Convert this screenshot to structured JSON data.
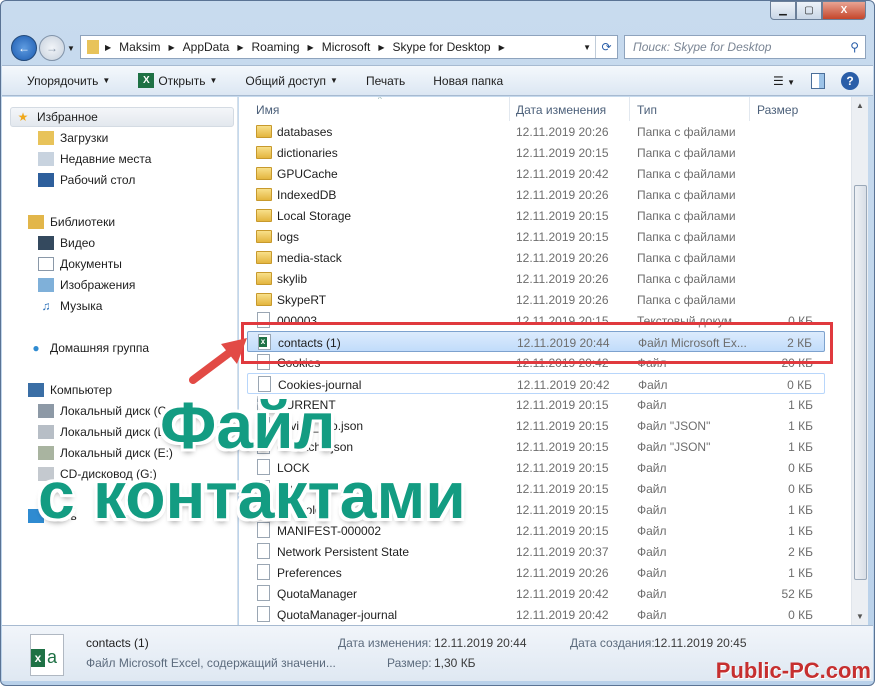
{
  "address": {
    "crumbs": [
      "Maksim",
      "AppData",
      "Roaming",
      "Microsoft",
      "Skype for Desktop"
    ]
  },
  "search": {
    "placeholder": "Поиск: Skype for Desktop"
  },
  "toolbar": {
    "organize": "Упорядочить",
    "open": "Открыть",
    "share": "Общий доступ",
    "print": "Печать",
    "new_folder": "Новая папка"
  },
  "sidebar": {
    "favorites": "Избранное",
    "downloads": "Загрузки",
    "recent": "Недавние места",
    "desktop": "Рабочий стол",
    "libraries": "Библиотеки",
    "video": "Видео",
    "documents": "Документы",
    "images": "Изображения",
    "music": "Музыка",
    "homegroup": "Домашняя группа",
    "computer": "Компьютер",
    "disk_c": "Локальный диск (C:)",
    "disk_d": "Локальный диск (D:)",
    "disk_e": "Локальный диск (E:)",
    "cd": "CD-дисковод (G:)",
    "network": "Сеть"
  },
  "columns": {
    "name": "Имя",
    "date": "Дата изменения",
    "type": "Тип",
    "size": "Размер"
  },
  "files": [
    {
      "name": "databases",
      "date": "12.11.2019 20:26",
      "type": "Папка с файлами",
      "size": "",
      "kind": "folder"
    },
    {
      "name": "dictionaries",
      "date": "12.11.2019 20:15",
      "type": "Папка с файлами",
      "size": "",
      "kind": "folder"
    },
    {
      "name": "GPUCache",
      "date": "12.11.2019 20:42",
      "type": "Папка с файлами",
      "size": "",
      "kind": "folder"
    },
    {
      "name": "IndexedDB",
      "date": "12.11.2019 20:26",
      "type": "Папка с файлами",
      "size": "",
      "kind": "folder"
    },
    {
      "name": "Local Storage",
      "date": "12.11.2019 20:15",
      "type": "Папка с файлами",
      "size": "",
      "kind": "folder"
    },
    {
      "name": "logs",
      "date": "12.11.2019 20:15",
      "type": "Папка с файлами",
      "size": "",
      "kind": "folder"
    },
    {
      "name": "media-stack",
      "date": "12.11.2019 20:26",
      "type": "Папка с файлами",
      "size": "",
      "kind": "folder"
    },
    {
      "name": "skylib",
      "date": "12.11.2019 20:26",
      "type": "Папка с файлами",
      "size": "",
      "kind": "folder"
    },
    {
      "name": "SkypeRT",
      "date": "12.11.2019 20:26",
      "type": "Папка с файлами",
      "size": "",
      "kind": "folder"
    },
    {
      "name": "000003",
      "date": "12.11.2019 20:15",
      "type": "Текстовый докум...",
      "size": "0 КБ",
      "kind": "file"
    },
    {
      "name": "contacts (1)",
      "date": "12.11.2019 20:44",
      "type": "Файл Microsoft Ex...",
      "size": "2 КБ",
      "kind": "xls",
      "state": "sel"
    },
    {
      "name": "Cookies",
      "date": "12.11.2019 20:42",
      "type": "Файл",
      "size": "20 КБ",
      "kind": "file"
    },
    {
      "name": "Cookies-journal",
      "date": "12.11.2019 20:42",
      "type": "Файл",
      "size": "0 КБ",
      "kind": "file",
      "state": "hov"
    },
    {
      "name": "CURRENT",
      "date": "12.11.2019 20:15",
      "type": "Файл",
      "size": "1 КБ",
      "kind": "file"
    },
    {
      "name": "device_info.json",
      "date": "12.11.2019 20:15",
      "type": "Файл \"JSON\"",
      "size": "1 КБ",
      "kind": "file"
    },
    {
      "name": "ecscache.json",
      "date": "12.11.2019 20:15",
      "type": "Файл \"JSON\"",
      "size": "1 КБ",
      "kind": "file"
    },
    {
      "name": "LOCK",
      "date": "12.11.2019 20:15",
      "type": "Файл",
      "size": "0 КБ",
      "kind": "file"
    },
    {
      "name": "LOG",
      "date": "12.11.2019 20:15",
      "type": "Файл",
      "size": "0 КБ",
      "kind": "file"
    },
    {
      "name": "LOG.old",
      "date": "12.11.2019 20:15",
      "type": "Файл",
      "size": "1 КБ",
      "kind": "file"
    },
    {
      "name": "MANIFEST-000002",
      "date": "12.11.2019 20:15",
      "type": "Файл",
      "size": "1 КБ",
      "kind": "file"
    },
    {
      "name": "Network Persistent State",
      "date": "12.11.2019 20:37",
      "type": "Файл",
      "size": "2 КБ",
      "kind": "file"
    },
    {
      "name": "Preferences",
      "date": "12.11.2019 20:26",
      "type": "Файл",
      "size": "1 КБ",
      "kind": "file"
    },
    {
      "name": "QuotaManager",
      "date": "12.11.2019 20:42",
      "type": "Файл",
      "size": "52 КБ",
      "kind": "file"
    },
    {
      "name": "QuotaManager-journal",
      "date": "12.11.2019 20:42",
      "type": "Файл",
      "size": "0 КБ",
      "kind": "file"
    }
  ],
  "details": {
    "name": "contacts (1)",
    "desc": "Файл Microsoft Excel, содержащий значени...",
    "modified_label": "Дата изменения:",
    "modified": "12.11.2019 20:44",
    "created_label": "Дата создания:",
    "created": "12.11.2019 20:45",
    "size_label": "Размер:",
    "size": "1,30 КБ"
  },
  "overlay": {
    "line1": "Файл",
    "line2": "с контактами"
  },
  "watermark": "Public-PC.com",
  "colors": {
    "highlight": "#e0393e",
    "overlay": "#139c82"
  }
}
